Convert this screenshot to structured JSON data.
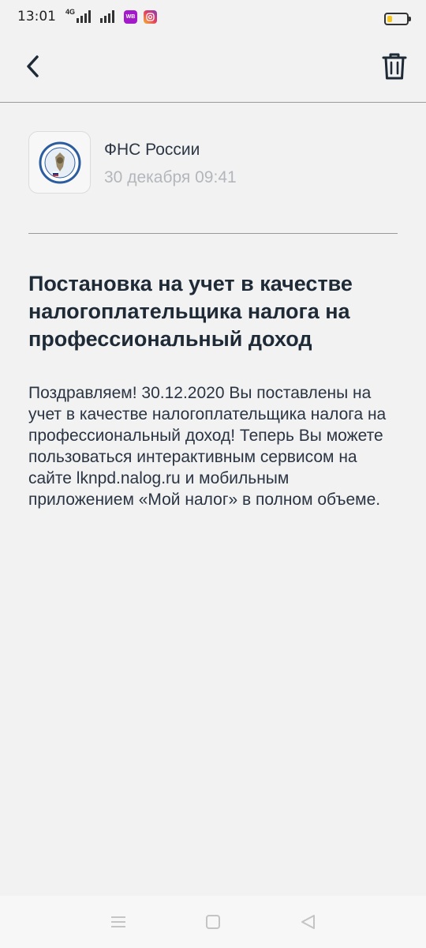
{
  "status_bar": {
    "time": "13:01",
    "network": "4G",
    "apps": [
      "WB"
    ],
    "battery_level": 0.25
  },
  "header": {
    "back_icon": "chevron-left-icon",
    "delete_icon": "trash-icon"
  },
  "message": {
    "sender": "ФНС России",
    "date": "30 декабря 09:41",
    "title": "Постановка на учет в качестве налогоплательщика налога на профессиональный доход",
    "body": "Поздравляем! 30.12.2020 Вы поставлены на учет в качестве налогоплательщика налога на профессиональный доход! Теперь Вы можете пользоваться интерактивным сервисом на сайте lknpd.nalog.ru и мобильным приложением «Мой налог» в полном объеме."
  },
  "nav": {
    "menu_icon": "menu-icon",
    "home_icon": "home-square-icon",
    "back_icon": "triangle-back-icon"
  }
}
